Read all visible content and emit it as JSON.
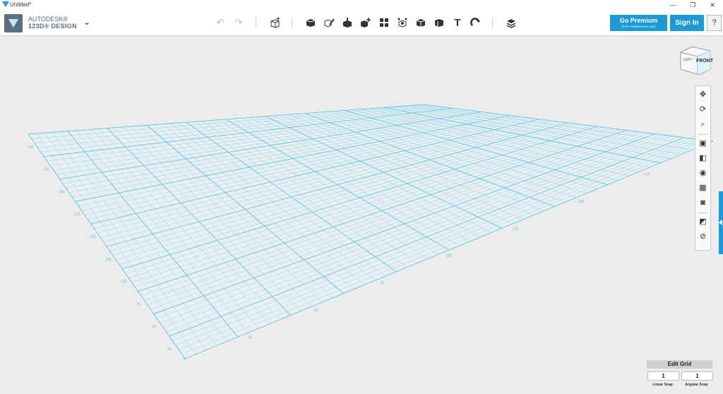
{
  "window": {
    "title": "Untitled*",
    "controls": {
      "minimize": "—",
      "restore": "❐",
      "close": "✕"
    }
  },
  "brand": {
    "line1": "AUTODESK®",
    "line2": "123D® DESIGN",
    "menu_icon": "chevron-down-icon"
  },
  "toolbar": {
    "undo_icon": "undo-icon",
    "redo_icon": "redo-icon",
    "tools": [
      "primitives-tool",
      "sketch-tool",
      "construct-tool",
      "modify-tool",
      "pattern-tool",
      "grouping-tool",
      "combine-tool",
      "measure-tool",
      "text-tool",
      "snap-tool",
      "material-tool"
    ],
    "text_tool_glyph": "T"
  },
  "account": {
    "premium_label": "Go Premium",
    "premium_sub": "(FOR COMMERCIAL USE)",
    "signin_label": "Sign In",
    "help_label": "?"
  },
  "viewcube": {
    "left": "LEFT",
    "front": "FRONT"
  },
  "grid": {
    "axis_labels_left": [
      "250",
      "225",
      "200",
      "175",
      "150",
      "125",
      "100",
      "75",
      "50",
      "25"
    ],
    "axis_labels_front": [
      "25",
      "50",
      "75",
      "100",
      "125",
      "150",
      "175"
    ],
    "origin_label": "0"
  },
  "navbar": [
    "pan-icon",
    "orbit-icon",
    "zoom-icon",
    "fit-icon",
    "view-mode-icon",
    "visibility-icon",
    "material-view-icon",
    "camera-icon",
    "snap-view-icon",
    "hide-icon"
  ],
  "grid_panel": {
    "edit_label": "Edit Grid",
    "linear_value": "1",
    "angular_value": "1",
    "linear_label": "Linear Snap",
    "angular_label": "Angular Snap"
  },
  "colors": {
    "accent": "#1b9ad6",
    "grid": "#56bfe0",
    "background": "#ececec"
  }
}
